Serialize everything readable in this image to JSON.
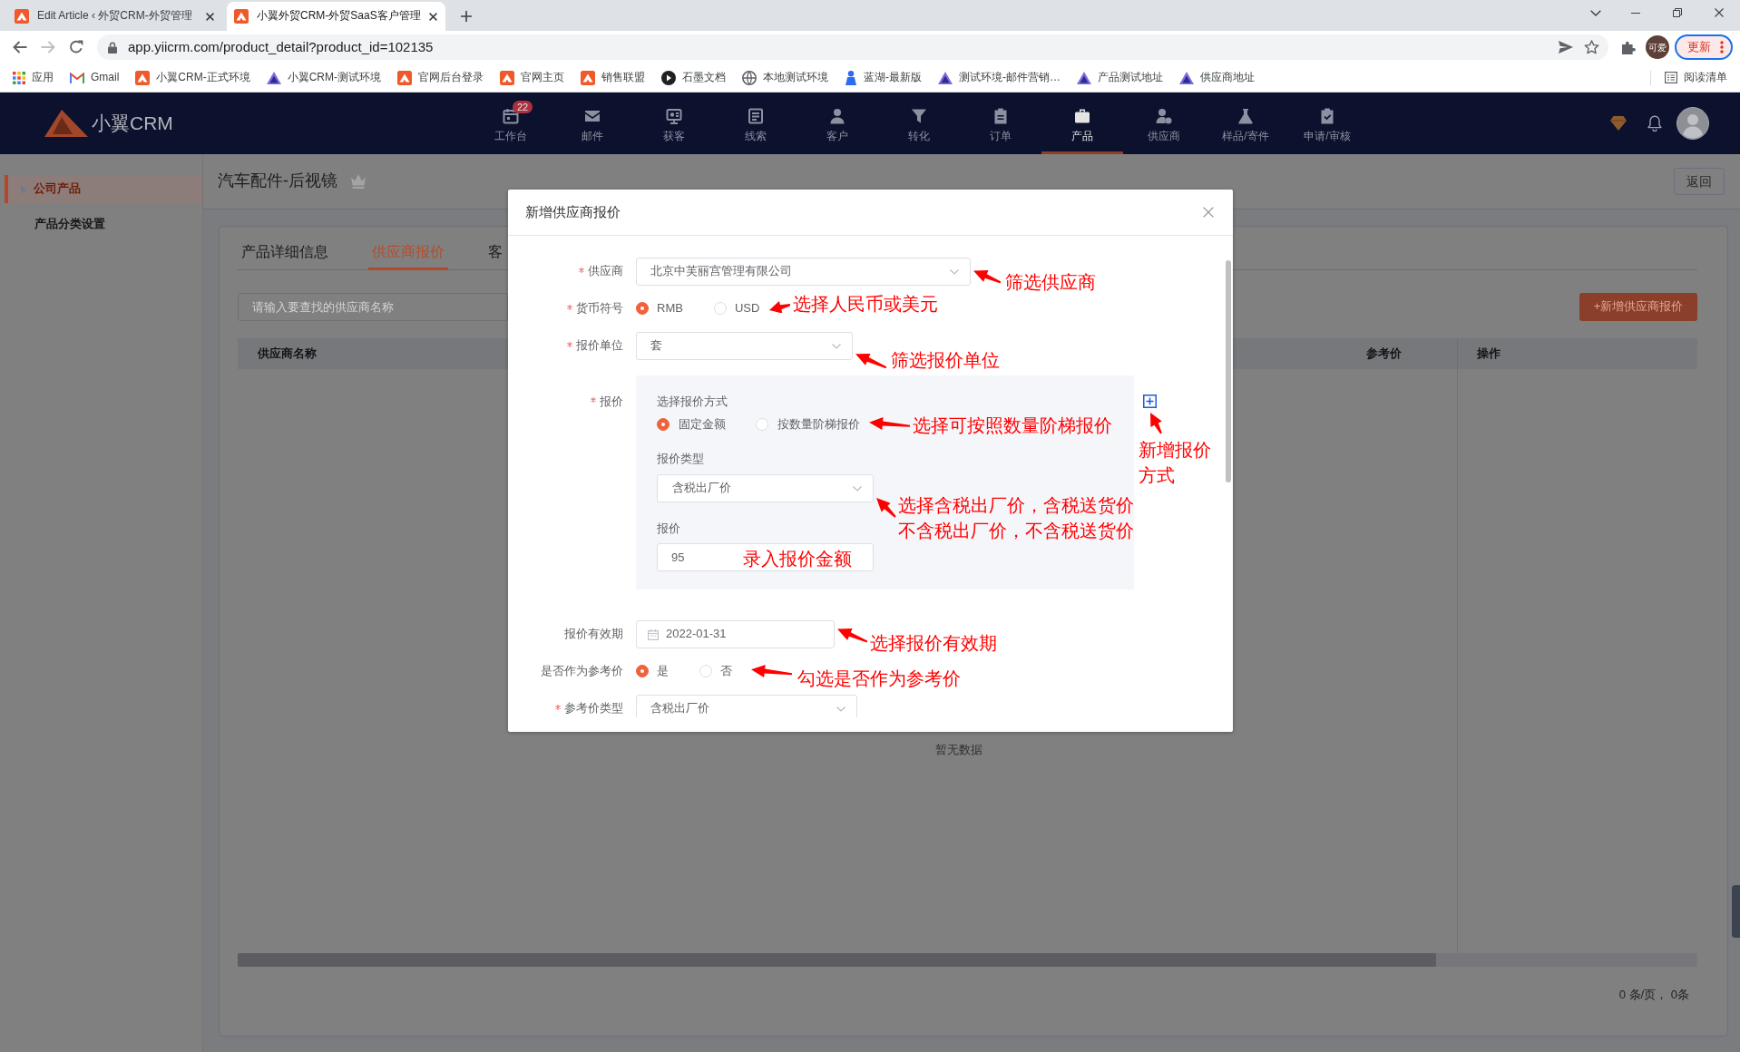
{
  "browser": {
    "tabs": [
      {
        "title": "Edit Article ‹ 外贸CRM-外贸管理",
        "selected": false
      },
      {
        "title": "小翼外贸CRM-外贸SaaS客户管理",
        "selected": true
      }
    ],
    "address": "app.yiicrm.com/product_detail?product_id=102135",
    "profile": "可爱",
    "update_button": "更新",
    "bookmarks": [
      {
        "label": "应用",
        "kind": "grid"
      },
      {
        "label": "Gmail",
        "kind": "mail"
      },
      {
        "label": "小翼CRM-正式环境",
        "kind": "logo"
      },
      {
        "label": "小翼CRM-测试环境",
        "kind": "tent"
      },
      {
        "label": "官网后台登录",
        "kind": "logo"
      },
      {
        "label": "官网主页",
        "kind": "logo"
      },
      {
        "label": "销售联盟",
        "kind": "logo"
      },
      {
        "label": "石墨文档",
        "kind": "disc"
      },
      {
        "label": "本地测试环境",
        "kind": "globe"
      },
      {
        "label": "蓝湖-最新版",
        "kind": "figure"
      },
      {
        "label": "测试环境-邮件营销…",
        "kind": "tent"
      },
      {
        "label": "产品测试地址",
        "kind": "tent"
      },
      {
        "label": "供应商地址",
        "kind": "tent"
      }
    ],
    "reading_list": "阅读清单"
  },
  "app_nav": {
    "logo": "小翼CRM",
    "items": [
      {
        "label": "工作台",
        "badge": "22",
        "selected": false
      },
      {
        "label": "邮件",
        "selected": false
      },
      {
        "label": "获客",
        "selected": false
      },
      {
        "label": "线索",
        "selected": false
      },
      {
        "label": "客户",
        "selected": false
      },
      {
        "label": "转化",
        "selected": false
      },
      {
        "label": "订单",
        "selected": false
      },
      {
        "label": "产品",
        "selected": true
      },
      {
        "label": "供应商",
        "selected": false
      },
      {
        "label": "样品/寄件",
        "selected": false
      },
      {
        "label": "申请/审核",
        "selected": false
      }
    ]
  },
  "sidebar": {
    "items": [
      {
        "label": "公司产品",
        "selected": true
      },
      {
        "label": "产品分类设置",
        "selected": false
      }
    ]
  },
  "page": {
    "title": "汽车配件-后视镜",
    "back_button": "返回",
    "tabs": [
      {
        "label": "产品详细信息",
        "selected": false
      },
      {
        "label": "供应商报价",
        "selected": true
      },
      {
        "label": "客",
        "selected": false
      }
    ],
    "search": {
      "placeholder": "请输入要查找的供应商名称"
    },
    "add_button": "+新增供应商报价",
    "table": {
      "columns": [
        "供应商名称",
        "参考价",
        "操作"
      ],
      "empty_text": "暂无数据"
    },
    "pagination": "0 条/页， 0条"
  },
  "modal": {
    "title": "新增供应商报价",
    "fields": [
      {
        "kind": "select",
        "label": "供应商",
        "required": true,
        "value": "北京中芙丽宫管理有限公司"
      },
      {
        "kind": "radio",
        "label": "货币符号",
        "required": true,
        "options": [
          {
            "label": "RMB",
            "selected": true
          },
          {
            "label": "USD",
            "selected": false
          }
        ]
      },
      {
        "kind": "select",
        "label": "报价单位",
        "required": true,
        "value": "套"
      },
      {
        "kind": "panel",
        "label": "报价",
        "required": true,
        "method_label": "选择报价方式",
        "methods": [
          {
            "label": "固定金额",
            "selected": true
          },
          {
            "label": "按数量阶梯报价",
            "selected": false
          }
        ],
        "type_label": "报价类型",
        "type_value": "含税出厂价",
        "price_label": "报价",
        "price_value": "95"
      },
      {
        "kind": "date",
        "label": "报价有效期",
        "required": false,
        "value": "2022-01-31"
      },
      {
        "kind": "radio",
        "label": "是否作为参考价",
        "required": false,
        "options": [
          {
            "label": "是",
            "selected": true
          },
          {
            "label": "否",
            "selected": false
          }
        ]
      },
      {
        "kind": "select",
        "label": "参考价类型",
        "required": true,
        "value": "含税出厂价"
      }
    ],
    "annotations": [
      {
        "lines": [
          "筛选供应商"
        ]
      },
      {
        "lines": [
          "选择人民币或美元"
        ]
      },
      {
        "lines": [
          "筛选报价单位"
        ]
      },
      {
        "lines": [
          "选择可按照数量阶梯报价"
        ]
      },
      {
        "lines": [
          "选择含税出厂价，含税送货价",
          "不含税出厂价，不含税送货价"
        ]
      },
      {
        "lines": [
          "录入报价金额"
        ]
      },
      {
        "lines": [
          "新增报价",
          "方式"
        ]
      },
      {
        "lines": [
          "选择报价有效期"
        ]
      },
      {
        "lines": [
          "勾选是否作为参考价"
        ]
      }
    ]
  }
}
